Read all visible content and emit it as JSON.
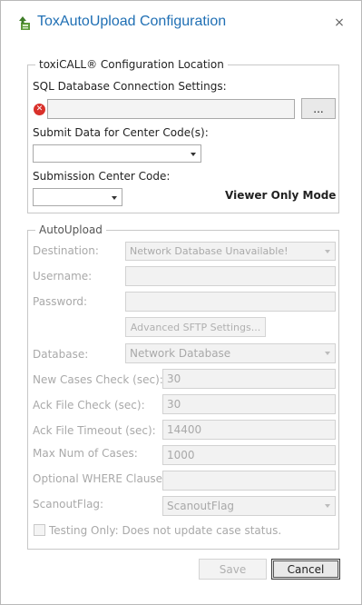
{
  "window": {
    "title": "ToxAutoUpload Configuration",
    "close_glyph": "×"
  },
  "config_location": {
    "legend": "toxiCALL® Configuration Location",
    "sql_label": "SQL Database Connection Settings:",
    "sql_value": "",
    "browse_label": "...",
    "center_codes_label": "Submit Data for Center Code(s):",
    "center_codes_value": "",
    "submission_label": "Submission Center Code:",
    "submission_value": "",
    "viewer_only": "Viewer Only Mode"
  },
  "auto_upload": {
    "legend": "AutoUpload",
    "destination_label": "Destination:",
    "destination_value": "Network Database Unavailable!",
    "username_label": "Username:",
    "username_value": "",
    "password_label": "Password:",
    "password_value": "",
    "sftp_button": "Advanced SFTP Settings...",
    "database_label": "Database:",
    "database_value": "Network Database",
    "new_cases_label": "New Cases Check (sec):",
    "new_cases_value": "30",
    "ack_check_label": "Ack File Check (sec):",
    "ack_check_value": "30",
    "ack_timeout_label": "Ack File Timeout (sec):",
    "ack_timeout_value": "14400",
    "max_cases_label": "Max Num of Cases:",
    "max_cases_value": "1000",
    "where_label": "Optional WHERE Clause:",
    "where_value": "",
    "scanout_label": "ScanoutFlag:",
    "scanout_value": "ScanoutFlag",
    "testing_label": "Testing Only: Does not update case status."
  },
  "buttons": {
    "save": "Save",
    "cancel": "Cancel"
  },
  "colors": {
    "title": "#1f6fb4",
    "error": "#d9302a",
    "disabled_text": "#a9a9a9"
  },
  "icons": {
    "app": "upload-icon",
    "error": "error-circle-icon",
    "close": "close-icon"
  }
}
